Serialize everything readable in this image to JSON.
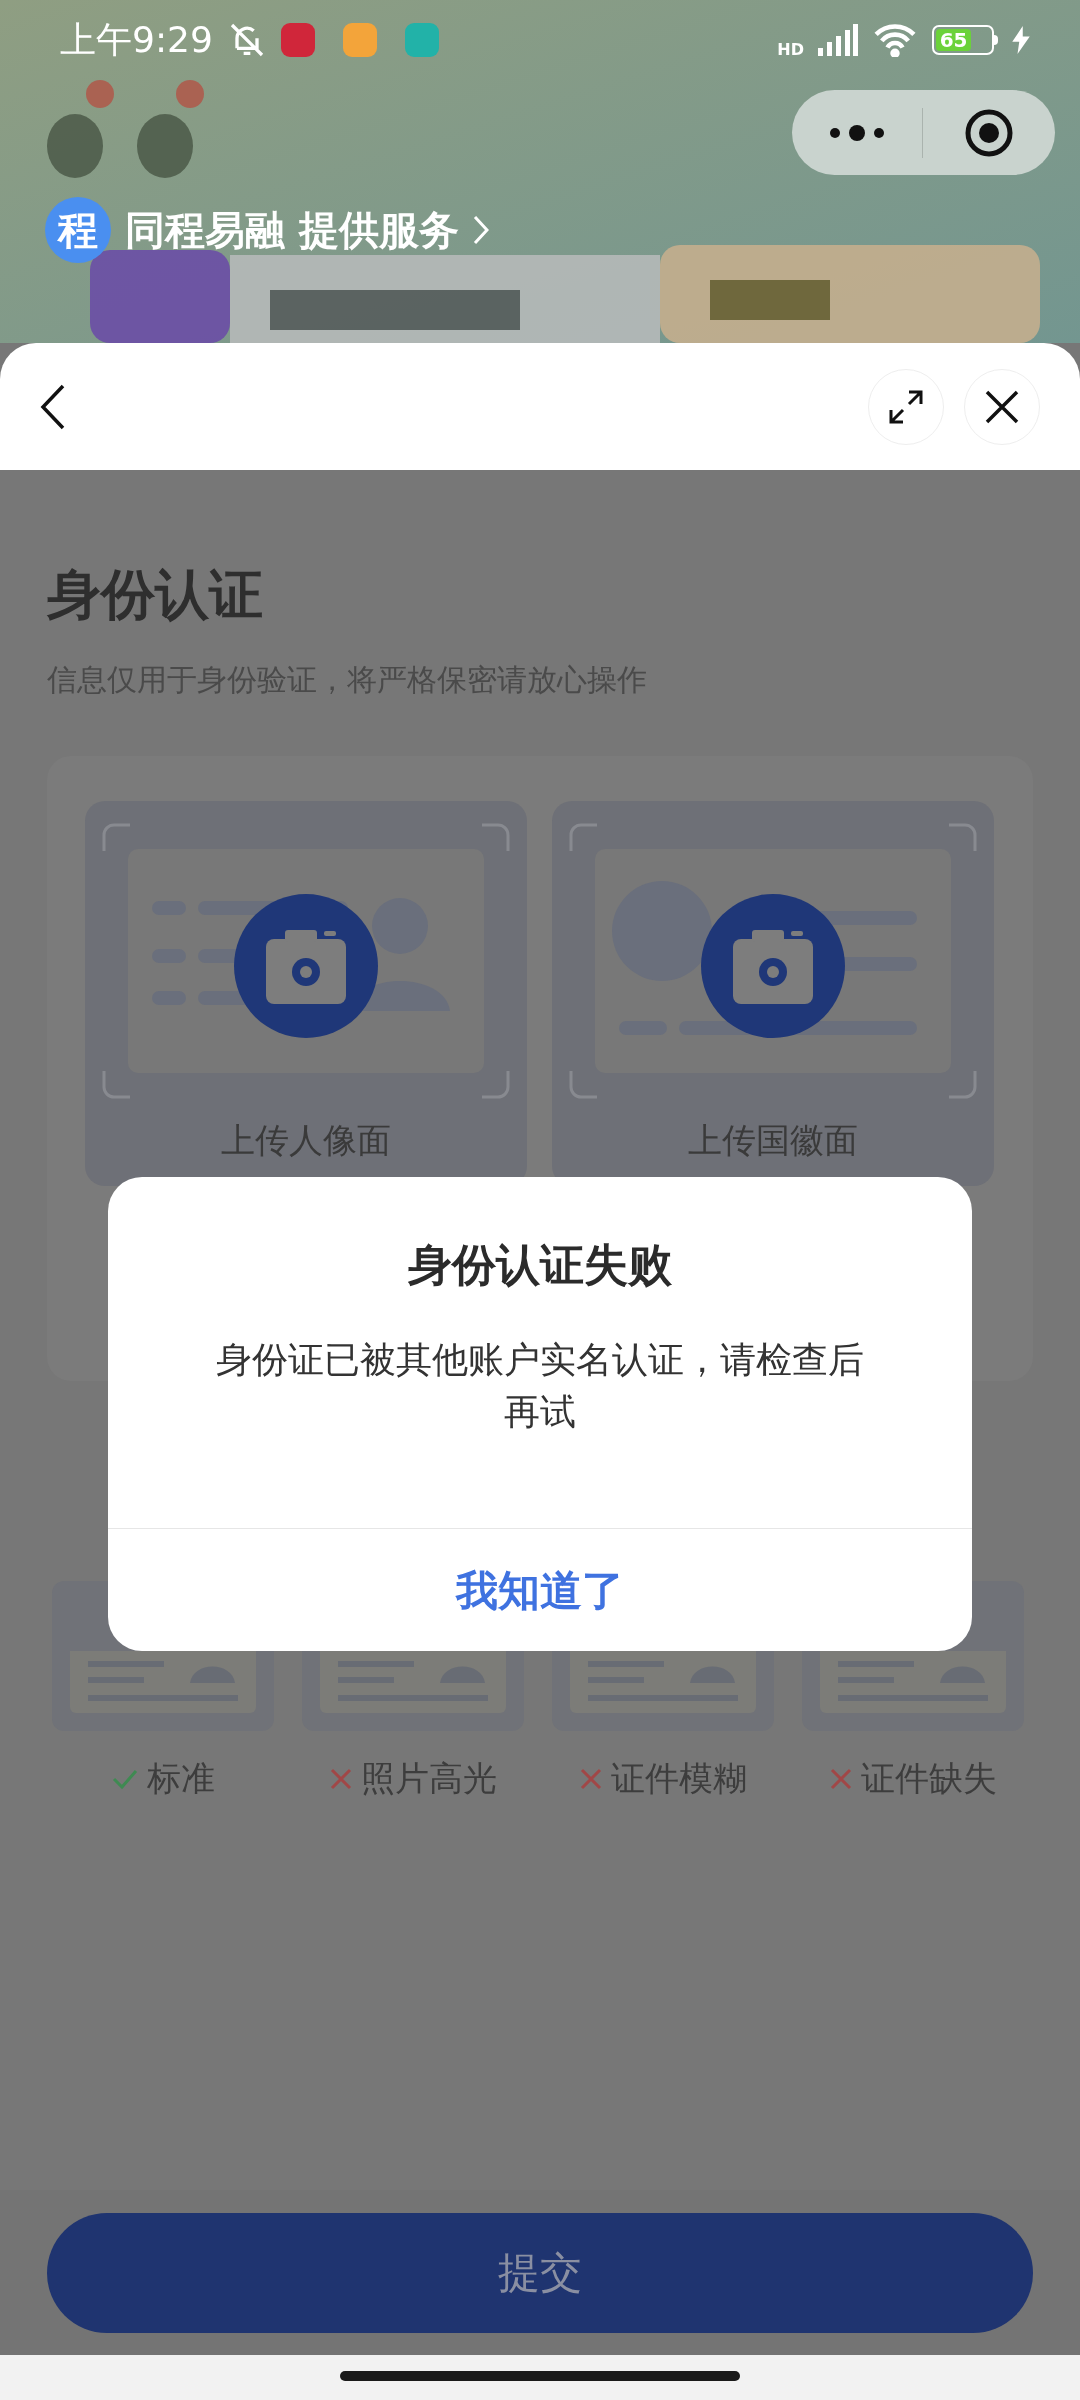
{
  "status_bar": {
    "time": "上午9:29",
    "network": "HD",
    "battery": "65"
  },
  "provider": {
    "logo": "程",
    "text": "同程易融 提供服务"
  },
  "page": {
    "title": "身份认证",
    "subtitle": "信息仅用于身份验证，将严格保密请放心操作"
  },
  "upload_cards": [
    {
      "label": "上传人像面",
      "kind": "portrait"
    },
    {
      "label": "上传国徽面",
      "kind": "emblem"
    }
  ],
  "examples": [
    {
      "label": "标准",
      "kind": "correct"
    },
    {
      "label": "照片高光",
      "kind": "wrong"
    },
    {
      "label": "证件模糊",
      "kind": "wrong"
    },
    {
      "label": "证件缺失",
      "kind": "wrong"
    }
  ],
  "submit": {
    "label": "提交"
  },
  "dialog": {
    "title": "身份认证失败",
    "message": "身份证已被其他账户实名认证，请检查后再试",
    "button": "我知道了"
  }
}
